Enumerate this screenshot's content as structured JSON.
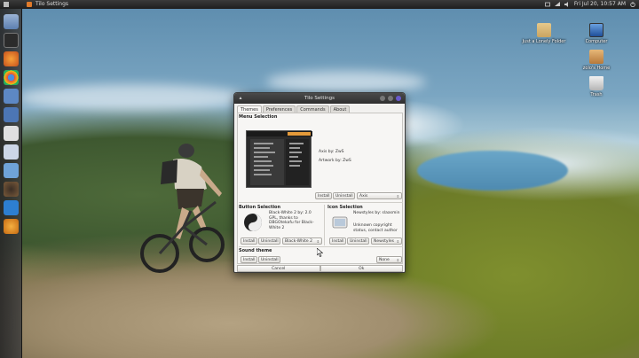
{
  "top_panel": {
    "title": "Tilo Settings",
    "clock": "Fri Jul 20, 10:57 AM"
  },
  "launcher": {
    "items": [
      "home-folder",
      "terminal",
      "firefox",
      "chrome",
      "monitor",
      "gimp",
      "theme",
      "calendar",
      "media",
      "inkscape",
      "blender"
    ]
  },
  "desktop_icons": [
    {
      "label": "Just a Lonely Folder",
      "icon": "folder-icon"
    },
    {
      "label": "Computer",
      "icon": "computer-icon"
    },
    {
      "label": "zolo's Home",
      "icon": "home-icon"
    },
    {
      "label": "Trash",
      "icon": "trash-icon"
    }
  ],
  "window": {
    "title": "Tilo Settings",
    "tabs": [
      "Themes",
      "Preferences",
      "Commands",
      "About"
    ],
    "active_tab": "Themes",
    "menu_selection": {
      "heading": "Menu Selection",
      "author_line": "Axis by: ZwS",
      "artwork_line": "Artwork by: ZwS",
      "install_label": "Install",
      "uninstall_label": "Uninstall",
      "selected": "Axis"
    },
    "button_selection": {
      "heading": "Button Selection",
      "info": "Black-White 2 by: 2.0 GPL, thanks to DBGOtekafu for Black-White 2",
      "install_label": "Install",
      "uninstall_label": "Uninstall",
      "selected": "Black-White 2"
    },
    "icon_selection": {
      "heading": "Icon Selection",
      "info_top": "Newstyles by: slaasmin",
      "info_bottom": "Unknown copyright status, contact author",
      "install_label": "Install",
      "uninstall_label": "Uninstall",
      "selected": "Newstyles"
    },
    "sound_theme": {
      "heading": "Sound theme",
      "install_label": "Install",
      "uninstall_label": "Uninstall",
      "selected": "None"
    },
    "footer": {
      "cancel_label": "Cancel",
      "ok_label": "Ok"
    }
  },
  "colors": {
    "panel": "#262626",
    "window_bg": "#f2f1ef",
    "titlebar": "#3a3a3a",
    "accent_orange": "#e07a2a"
  }
}
